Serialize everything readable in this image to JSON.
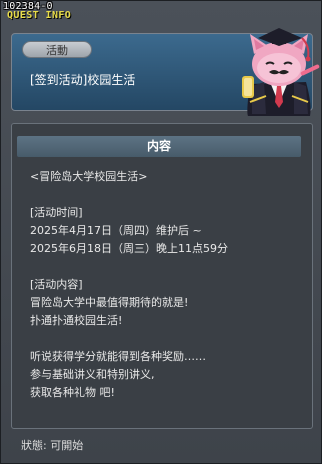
{
  "window": {
    "id_label": "102384-0",
    "title": "QUEST INFO"
  },
  "header": {
    "tag": "活動",
    "event_title": "[签到活动]校园生活"
  },
  "content": {
    "section_title": "内容",
    "lines": [
      "<冒险岛大学校园生活>",
      "",
      "[活动时间]",
      "2025年4月17日（周四）维护后 ~",
      "2025年6月18日（周三）晚上11点59分",
      "",
      "[活动内容]",
      "冒险岛大学中最值得期待的就是!",
      "扑通扑通校园生活!",
      "",
      "听说获得学分就能得到各种奖励……",
      "参与基础讲义和特别讲义,",
      "获取各种礼物 吧!"
    ]
  },
  "footer": {
    "status": "狀態:  可開始"
  },
  "colors": {
    "title_yellow": "#e8dc4a",
    "header_blue": "#2f5a7c",
    "section_bar": "#526878"
  },
  "icons": {
    "mascot": "pink-cat-professor-icon"
  }
}
